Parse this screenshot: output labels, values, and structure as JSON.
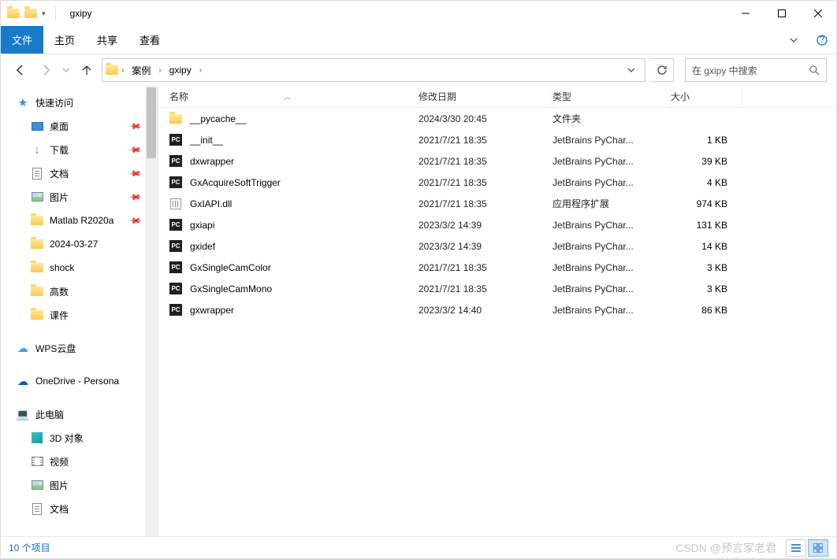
{
  "title": "gxipy",
  "tabs": {
    "file": "文件",
    "home": "主页",
    "share": "共享",
    "view": "查看"
  },
  "breadcrumb": [
    "案例",
    "gxipy"
  ],
  "search_placeholder": "在 gxipy 中搜索",
  "sidebar": {
    "quick": "快速访问",
    "desktop": "桌面",
    "downloads": "下载",
    "documents": "文档",
    "pictures": "图片",
    "matlab": "Matlab R2020a",
    "d20240327": "2024-03-27",
    "shock": "shock",
    "gaoshu": "高数",
    "kejian": "课件",
    "wps": "WPS云盘",
    "onedrive": "OneDrive - Persona",
    "thispc": "此电脑",
    "obj3d": "3D 对象",
    "videos": "视频",
    "pictures2": "图片",
    "documents2": "文档"
  },
  "columns": {
    "name": "名称",
    "date": "修改日期",
    "type": "类型",
    "size": "大小"
  },
  "files": [
    {
      "icon": "folder",
      "name": "__pycache__",
      "date": "2024/3/30 20:45",
      "type": "文件夹",
      "size": ""
    },
    {
      "icon": "pc",
      "name": "__init__",
      "date": "2021/7/21 18:35",
      "type": "JetBrains PyChar...",
      "size": "1 KB"
    },
    {
      "icon": "pc",
      "name": "dxwrapper",
      "date": "2021/7/21 18:35",
      "type": "JetBrains PyChar...",
      "size": "39 KB"
    },
    {
      "icon": "pc",
      "name": "GxAcquireSoftTrigger",
      "date": "2021/7/21 18:35",
      "type": "JetBrains PyChar...",
      "size": "4 KB"
    },
    {
      "icon": "dll",
      "name": "GxIAPI.dll",
      "date": "2021/7/21 18:35",
      "type": "应用程序扩展",
      "size": "974 KB"
    },
    {
      "icon": "pc",
      "name": "gxiapi",
      "date": "2023/3/2 14:39",
      "type": "JetBrains PyChar...",
      "size": "131 KB"
    },
    {
      "icon": "pc",
      "name": "gxidef",
      "date": "2023/3/2 14:39",
      "type": "JetBrains PyChar...",
      "size": "14 KB"
    },
    {
      "icon": "pc",
      "name": "GxSingleCamColor",
      "date": "2021/7/21 18:35",
      "type": "JetBrains PyChar...",
      "size": "3 KB"
    },
    {
      "icon": "pc",
      "name": "GxSingleCamMono",
      "date": "2021/7/21 18:35",
      "type": "JetBrains PyChar...",
      "size": "3 KB"
    },
    {
      "icon": "pc",
      "name": "gxwrapper",
      "date": "2023/3/2 14:40",
      "type": "JetBrains PyChar...",
      "size": "86 KB"
    }
  ],
  "status": "10 个项目",
  "watermark": "CSDN @预言家老君"
}
